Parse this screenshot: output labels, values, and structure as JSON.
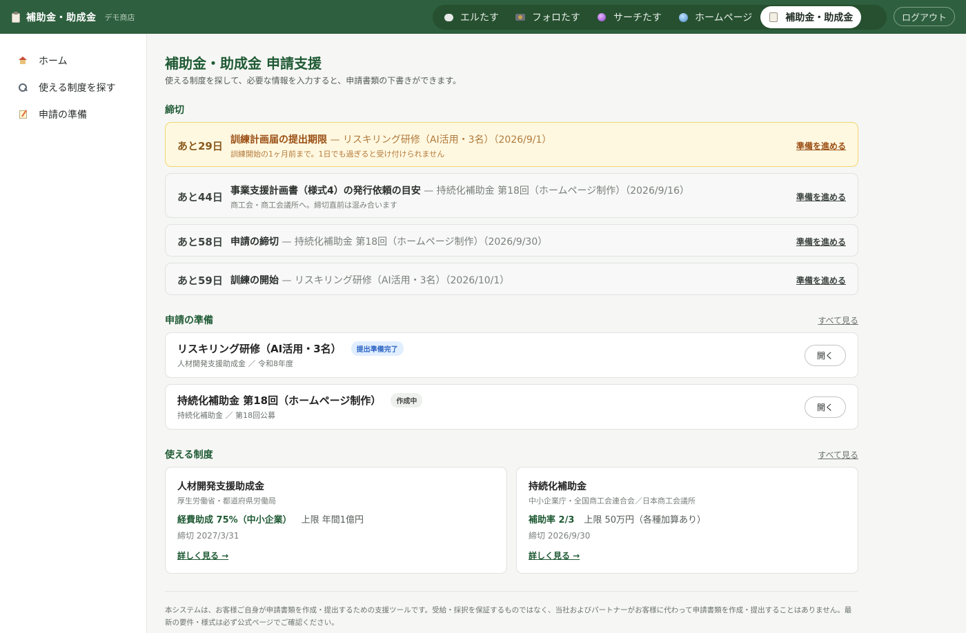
{
  "header": {
    "brand": "補助金・助成金",
    "shop": "デモ商店",
    "nav": [
      {
        "label": "エルたす",
        "icon": "speech-bubble-icon"
      },
      {
        "label": "フォロたす",
        "icon": "camera-icon"
      },
      {
        "label": "サーチたす",
        "icon": "crystal-ball-icon"
      },
      {
        "label": "ホームページ",
        "icon": "globe-icon"
      },
      {
        "label": "補助金・助成金",
        "icon": "notepad-icon",
        "active": true
      }
    ],
    "logout": "ログアウト"
  },
  "sidebar": {
    "items": [
      {
        "label": "ホーム",
        "icon": "house-icon"
      },
      {
        "label": "使える制度を探す",
        "icon": "magnifier-icon"
      },
      {
        "label": "申請の準備",
        "icon": "memo-icon"
      }
    ]
  },
  "main": {
    "title": "補助金・助成金 申請支援",
    "description": "使える制度を探して、必要な情報を入力すると、申請書類の下書きができます。",
    "deadlines": {
      "heading": "締切",
      "items": [
        {
          "days": "あと29日",
          "title": "訓練計画届の提出期限",
          "detail": "— リスキリング研修（AI活用・3名）（2026/9/1）",
          "note": "訓練開始の1ヶ月前まで。1日でも過ぎると受け付けられません",
          "link": "準備を進める",
          "urgent": true
        },
        {
          "days": "あと44日",
          "title": "事業支援計画書（様式4）の発行依頼の目安",
          "detail": "— 持続化補助金 第18回（ホームページ制作）（2026/9/16）",
          "note": "商工会・商工会議所へ。締切直前は混み合います",
          "link": "準備を進める"
        },
        {
          "days": "あと58日",
          "title": "申請の締切",
          "detail": "— 持続化補助金 第18回（ホームページ制作）（2026/9/30）",
          "link": "準備を進める"
        },
        {
          "days": "あと59日",
          "title": "訓練の開始",
          "detail": "— リスキリング研修（AI活用・3名）（2026/10/1）",
          "link": "準備を進める"
        }
      ]
    },
    "applications": {
      "heading": "申請の準備",
      "see_all": "すべて見る",
      "items": [
        {
          "title": "リスキリング研修（AI活用・3名）",
          "badge": "提出準備完了",
          "sub": "人材開発支援助成金 ／ 令和8年度",
          "button": "開く"
        },
        {
          "title": "持続化補助金 第18回（ホームページ制作）",
          "badge": "作成中",
          "sub": "持続化補助金 ／ 第18回公募",
          "button": "開く"
        }
      ]
    },
    "programs": {
      "heading": "使える制度",
      "see_all": "すべて見る",
      "items": [
        {
          "name": "人材開発支援助成金",
          "org": "厚生労働省・都道府県労働局",
          "rate": "経費助成 75%（中小企業）",
          "limit": "上限 年間1億円",
          "deadline": "締切 2027/3/31",
          "link": "詳しく見る →"
        },
        {
          "name": "持続化補助金",
          "org": "中小企業庁・全国商工会連合会／日本商工会議所",
          "rate": "補助率 2/3",
          "limit": "上限 50万円（各種加算あり）",
          "deadline": "締切 2026/9/30",
          "link": "詳しく見る →"
        }
      ]
    },
    "footer": "本システムは、お客様ご自身が申請書類を作成・提出するための支援ツールです。受給・採択を保証するものではなく、当社およびパートナーがお客様に代わって申請書類を作成・提出することはありません。最新の要件・様式は必ず公式ページでご確認ください。"
  }
}
